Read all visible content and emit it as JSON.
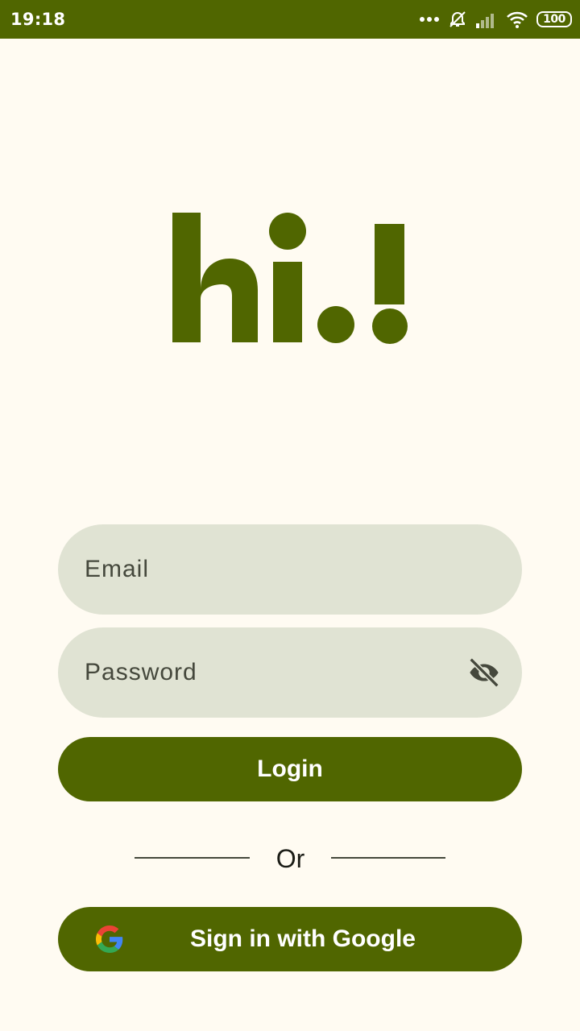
{
  "status_bar": {
    "time": "19:18",
    "battery": "100",
    "icons": [
      "more-dots-icon",
      "alarm-off-icon",
      "signal-icon",
      "wifi-icon",
      "battery-icon"
    ]
  },
  "logo": {
    "text": "hi.!"
  },
  "form": {
    "email_placeholder": "Email",
    "password_placeholder": "Password",
    "visibility_icon": "visibility-off-icon"
  },
  "login_button": {
    "label": "Login"
  },
  "divider": {
    "text": "Or"
  },
  "google_button": {
    "label": "Sign in with Google",
    "icon": "google-icon"
  },
  "colors": {
    "primary": "#506600",
    "background": "#fffbf2",
    "field": "#e0e3d3",
    "on_field": "#45483c"
  }
}
